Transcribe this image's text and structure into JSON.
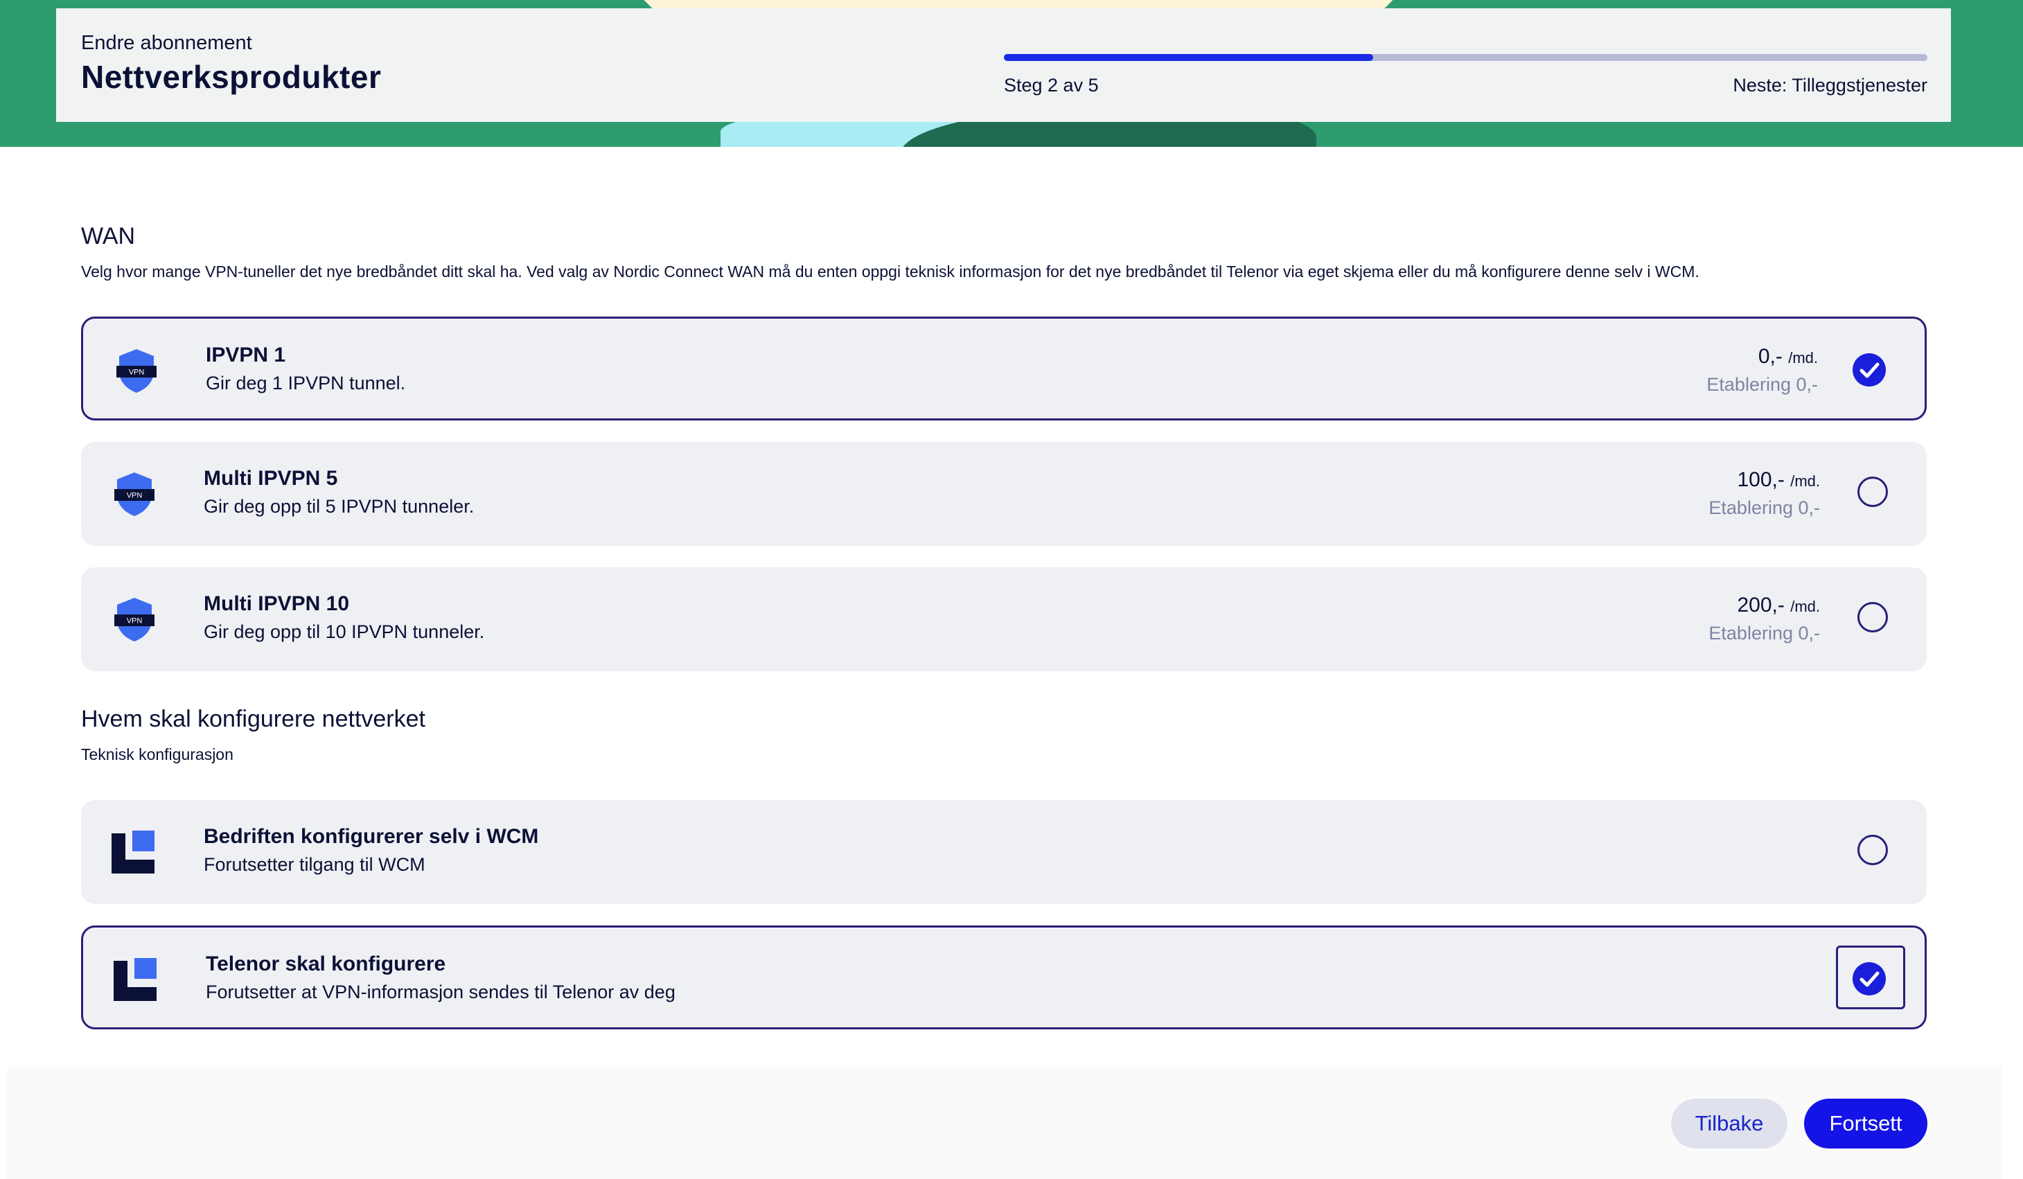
{
  "header": {
    "subtitle": "Endre abonnement",
    "title": "Nettverksprodukter",
    "progress_fraction": 0.4,
    "step_text": "Steg 2 av 5",
    "next_text": "Neste: Tilleggstjenester"
  },
  "wan": {
    "title": "WAN",
    "description": "Velg hvor mange VPN-tuneller det nye bredbåndet ditt skal ha. Ved valg av Nordic Connect WAN må du enten oppgi teknisk informasjon for det nye bredbåndet til Telenor via eget skjema eller du må konfigurere denne selv i WCM.",
    "options": [
      {
        "name": "IPVPN 1",
        "description": "Gir deg 1 IPVPN tunnel.",
        "price": "0,-",
        "unit": "/md.",
        "establishment": "Etablering 0,-",
        "selected": true,
        "icon": "vpn-shield-icon",
        "icon_label": "VPN"
      },
      {
        "name": "Multi IPVPN 5",
        "description": "Gir deg opp til 5 IPVPN tunneler.",
        "price": "100,-",
        "unit": "/md.",
        "establishment": "Etablering 0,-",
        "selected": false,
        "icon": "vpn-shield-icon",
        "icon_label": "VPN"
      },
      {
        "name": "Multi IPVPN 10",
        "description": "Gir deg opp til 10 IPVPN tunneler.",
        "price": "200,-",
        "unit": "/md.",
        "establishment": "Etablering 0,-",
        "selected": false,
        "icon": "vpn-shield-icon",
        "icon_label": "VPN"
      }
    ]
  },
  "config": {
    "title": "Hvem skal konfigurere nettverket",
    "description": "Teknisk konfigurasjon",
    "options": [
      {
        "name": "Bedriften konfigurerer selv i WCM",
        "description": "Forutsetter tilgang til WCM",
        "selected": false,
        "icon": "configuration-blocks-icon"
      },
      {
        "name": "Telenor skal konfigurere",
        "description": "Forutsetter at VPN-informasjon sendes til Telenor av deg",
        "selected": true,
        "focused": true,
        "icon": "configuration-blocks-icon"
      }
    ]
  },
  "footer": {
    "back_label": "Tilbake",
    "continue_label": "Fortsett"
  },
  "colors": {
    "brand_green": "#2f9c6f",
    "accent_blue": "#1a1fd9",
    "selected_border": "#2a1f7a",
    "card_bg": "#eff0f3"
  }
}
